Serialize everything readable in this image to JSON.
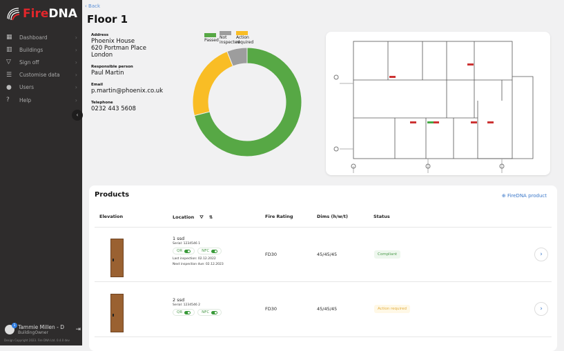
{
  "brand": {
    "name_part1": "Fire",
    "name_part2": "DNA"
  },
  "sidebar": {
    "items": [
      {
        "label": "Dashboard",
        "icon": "grid-icon"
      },
      {
        "label": "Buildings",
        "icon": "building-icon"
      },
      {
        "label": "Sign off",
        "icon": "signoff-icon"
      },
      {
        "label": "Customise data",
        "icon": "sliders-icon"
      },
      {
        "label": "Users",
        "icon": "users-icon"
      },
      {
        "label": "Help",
        "icon": "help-icon"
      }
    ],
    "user": {
      "name": "Tammie Millen - D",
      "role": "BuildingOwner",
      "badge": "1"
    },
    "copyright": "Design Copyright 2023. Fire DNA Ltd. 0.4.0 dev"
  },
  "header": {
    "back": "Back",
    "title": "Floor 1"
  },
  "info": {
    "address_label": "Address",
    "address": [
      "Phoenix House",
      "620 Portman Place",
      "London"
    ],
    "person_label": "Responsible person",
    "person": "Paul Martin",
    "email_label": "Email",
    "email": "p.martin@phoenix.co.uk",
    "phone_label": "Telephone",
    "phone": "0232 443 5608"
  },
  "chart_data": {
    "type": "pie",
    "donut": true,
    "legend": "top",
    "series": [
      {
        "name": "Passed",
        "value": 71,
        "color": "#57a845"
      },
      {
        "name": "Action required",
        "value": 23,
        "color": "#f9bd25"
      },
      {
        "name": "Not inspected",
        "value": 6,
        "color": "#9d9d9d"
      }
    ]
  },
  "products": {
    "title": "Products",
    "add": "FireDNA product",
    "columns": [
      "Elevation",
      "Location",
      "Fire Rating",
      "Dims (h/w/t)",
      "Status"
    ],
    "rows": [
      {
        "name": "1 ssd",
        "serial": "Serial: 1234546 1",
        "qr": "QR",
        "nfc": "NFC",
        "last": "Last inspection: 02.12.2022",
        "next": "Next inspection due: 02.12.2023",
        "rating": "FD30",
        "dims": "45/45/45",
        "status": "Compliant"
      },
      {
        "name": "2 ssd",
        "serial": "Serial: 1234546 2",
        "qr": "QR",
        "nfc": "NFC",
        "rating": "FD30",
        "dims": "45/45/45",
        "status": "Action required"
      }
    ]
  }
}
